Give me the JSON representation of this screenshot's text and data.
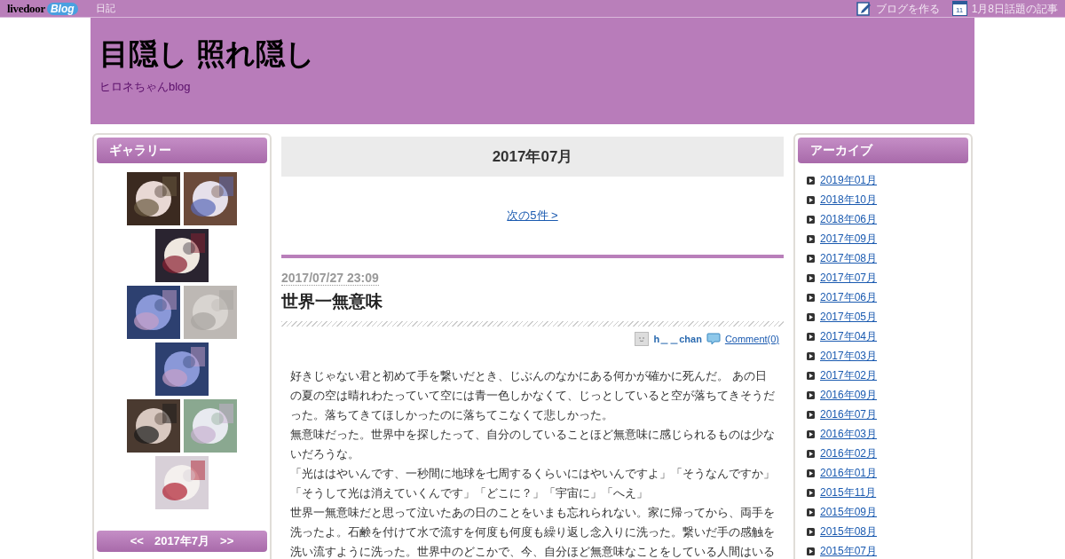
{
  "top_bar": {
    "logo": {
      "word": "livedoor",
      "badge": "Blog"
    },
    "section_link": "日記",
    "links": [
      {
        "kind": "edit",
        "label": "ブログを作る"
      },
      {
        "kind": "calendar",
        "label": "1月8日話題の記事",
        "icon_text": "11"
      }
    ]
  },
  "header": {
    "title": "目隠し 照れ隠し",
    "subtitle": "ヒロネちゃんblog"
  },
  "gallery": {
    "title": "ギャラリー"
  },
  "calendar": {
    "prev": "<<",
    "month": "2017年7月",
    "next": ">>"
  },
  "main": {
    "month_heading": "2017年07月",
    "next_link": "次の5件 >",
    "post": {
      "date": "2017/07/27 23:09",
      "title": "世界一無意味",
      "author": "h＿＿chan",
      "comments": "Comment(0)",
      "paragraphs": [
        "好きじゃない君と初めて手を繋いだとき、じぶんのなかにある何かが確かに死んだ。 あの日の夏の空は晴れわたっていて空には青一色しかなくて、じっとしていると空が落ちてきそうだった。落ちてきてほしかったのに落ちてこなくて悲しかった。",
        "無意味だった。世界中を探したって、自分のしていることほど無意味に感じられるものは少ないだろうな。",
        "「光ははやいんです、一秒間に地球を七周するくらいにはやいんですよ」「そうなんですか」",
        "「そうして光は消えていくんです」「どこに？」「宇宙に」「へえ」",
        "世界一無意味だと思って泣いたあの日のことをいまも忘れられない。家に帰ってから、両手を洗ったよ。石鹸を付けて水で流すを何度も何度も繰り返し念入りに洗った。繋いだ手の感触を洗い流すように洗った。世界中のどこかで、今、自分ほど無意味なことをしている人間はいる"
      ]
    }
  },
  "archive": {
    "title": "アーカイブ",
    "items": [
      "2019年01月",
      "2018年10月",
      "2018年06月",
      "2017年09月",
      "2017年08月",
      "2017年07月",
      "2017年06月",
      "2017年05月",
      "2017年04月",
      "2017年03月",
      "2017年02月",
      "2016年09月",
      "2016年07月",
      "2016年03月",
      "2016年02月",
      "2016年01月",
      "2015年11月",
      "2015年09月",
      "2015年08月",
      "2015年07月"
    ]
  }
}
